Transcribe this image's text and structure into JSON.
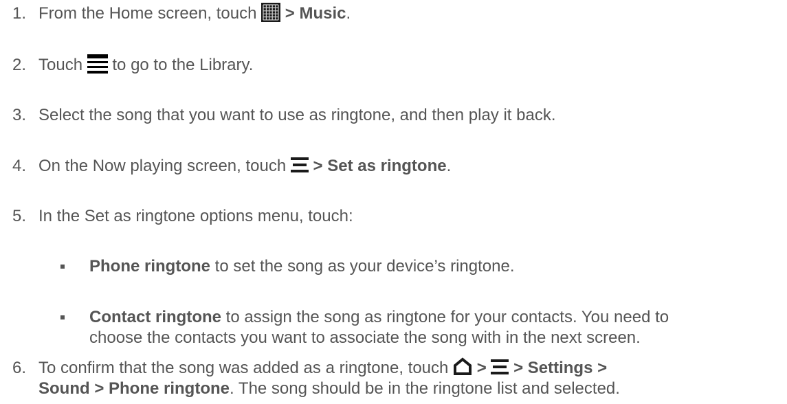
{
  "steps": [
    {
      "num": "1.",
      "a": "From the Home screen, touch ",
      "b": " > Music",
      "c": ".",
      "icon": "apps-grid-icon"
    },
    {
      "num": "2.",
      "a": "Touch ",
      "b": " to go to the Library.",
      "icon": "library-menu-icon"
    },
    {
      "num": "3.",
      "a": "Select the song that you want to use as ringtone, and then play it back."
    },
    {
      "num": "4.",
      "a": "On the Now playing screen, touch ",
      "b": " > Set as ringtone",
      "c": ".",
      "icon": "menu-icon"
    },
    {
      "num": "5.",
      "a": "In the Set as ringtone options menu, touch:"
    },
    {
      "num": "6.",
      "a": "To confirm that the song was added as a ringtone, touch ",
      "b": " > ",
      "c": " > Settings >",
      "d": "Sound > Phone ringtone",
      "e": ". The song should be in the ringtone list and selected.",
      "icons": [
        "home-icon",
        "menu-icon"
      ]
    }
  ],
  "bullets": [
    {
      "bold": "Phone ringtone",
      "text": " to set the song as your device’s ringtone."
    },
    {
      "bold": "Contact ringtone",
      "text": " to assign the song as ringtone for your contacts. You need to",
      "line2": "choose the contacts you want to associate the song with in the next screen."
    }
  ]
}
